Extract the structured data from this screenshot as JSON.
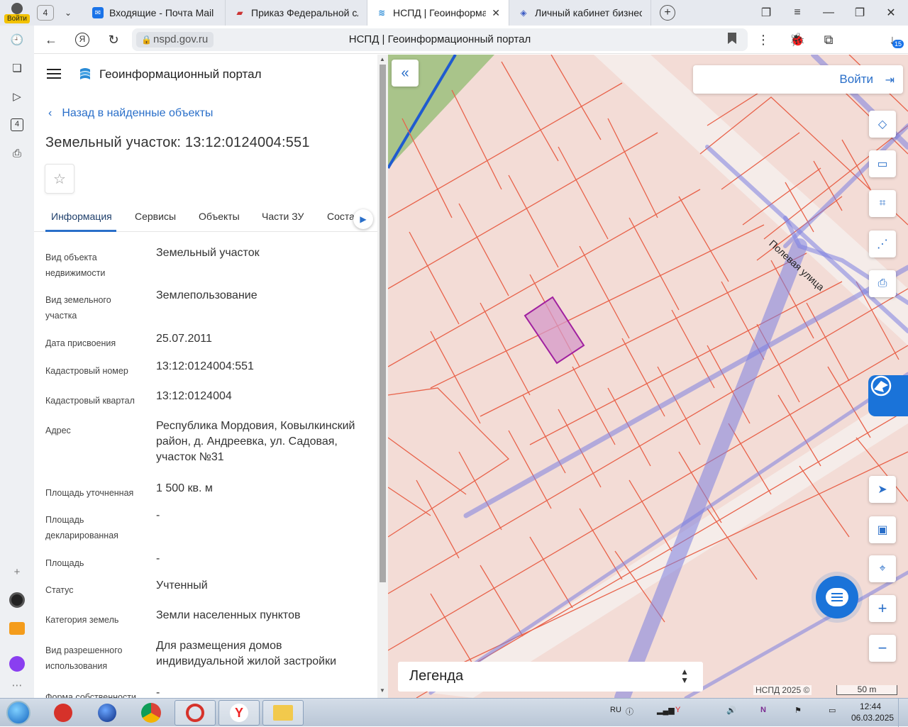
{
  "browser": {
    "tab_counter": "4",
    "tabs": [
      {
        "label": "Входящие - Почта Mail",
        "active": false
      },
      {
        "label": "Приказ Федеральной слу",
        "active": false
      },
      {
        "label": "НСПД | Геоинформаци",
        "active": true
      },
      {
        "label": "Личный кабинет бизнес-с",
        "active": false
      }
    ],
    "login_badge": "Войти",
    "url": "nspd.gov.ru",
    "page_title": "НСПД | Геоинформационный портал",
    "downloads_badge": "15",
    "rail_counter": "4"
  },
  "portal": {
    "brand": "Геоинформационный портал",
    "back_link": "Назад в найденные объекты",
    "object_title": "Земельный участок: 13:12:0124004:551",
    "tabs": [
      {
        "label": "Информация",
        "active": true
      },
      {
        "label": "Сервисы",
        "active": false
      },
      {
        "label": "Объекты",
        "active": false
      },
      {
        "label": "Части ЗУ",
        "active": false
      },
      {
        "label": "Соста",
        "active": false
      }
    ],
    "properties": [
      {
        "key": "Вид объекта недвижимости",
        "value": "Земельный участок"
      },
      {
        "key": "Вид земельного участка",
        "value": "Землепользование"
      },
      {
        "key": "Дата присвоения",
        "value": "25.07.2011"
      },
      {
        "key": "Кадастровый номер",
        "value": "13:12:0124004:551"
      },
      {
        "key": "Кадастровый квартал",
        "value": "13:12:0124004"
      },
      {
        "key": "Адрес",
        "value": "Республика Мордовия, Ковылкинский район, д. Андреевка, ул. Садовая, участок №31"
      },
      {
        "key": "Площадь уточненная",
        "value": "1 500 кв. м"
      },
      {
        "key": "Площадь декларированная",
        "value": "-"
      },
      {
        "key": "Площадь",
        "value": "-"
      },
      {
        "key": "Статус",
        "value": "Учтенный"
      },
      {
        "key": "Категория земель",
        "value": "Земли населенных пунктов"
      },
      {
        "key": "Вид разрешенного использования",
        "value": "Для размещения домов индивидуальной жилой застройки"
      },
      {
        "key": "Форма собственности",
        "value": "-"
      }
    ]
  },
  "map": {
    "login_label": "Войти",
    "street_label": "Полевая улица",
    "legend_label": "Легенда",
    "copyright": "НСПД 2025 ©",
    "scale_label": "50 m",
    "parcel_color": "#e8624a",
    "selected_color": "#a020a0",
    "road_color": "#7b7fe0"
  },
  "taskbar": {
    "lang": "RU",
    "time": "12:44",
    "date": "06.03.2025"
  }
}
